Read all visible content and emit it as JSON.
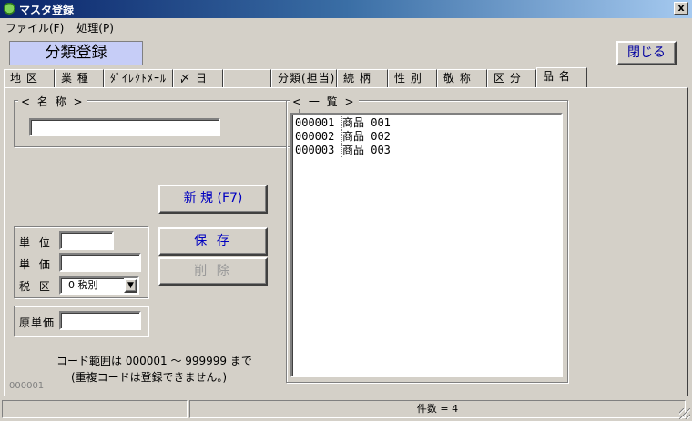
{
  "window": {
    "title": "マスタ登録",
    "close_glyph": "x"
  },
  "menu": [
    {
      "label": "ファイル(F)"
    },
    {
      "label": "処理(P)"
    }
  ],
  "header": {
    "title": "分類登録",
    "close_button": "閉じる"
  },
  "tabs": [
    {
      "label": "地 区"
    },
    {
      "label": "業 種"
    },
    {
      "label": "ﾀﾞｲﾚｸﾄﾒｰﾙ"
    },
    {
      "label": "〆 日"
    },
    {
      "label": ""
    },
    {
      "label": "分類(担当)"
    },
    {
      "label": "続 柄"
    },
    {
      "label": "性 別"
    },
    {
      "label": "敬 称"
    },
    {
      "label": "区 分"
    },
    {
      "label": "品 名"
    }
  ],
  "form": {
    "name_group_label": "< 名 称 >",
    "name_value": "",
    "unit_label": "単 位",
    "unit_value": "",
    "price_label": "単 価",
    "price_value": "",
    "tax_label": "税 区",
    "tax_selected": "0 税別",
    "cost_label": "原単価",
    "cost_value": ""
  },
  "buttons": {
    "new": "新 規 (F7)",
    "save": "保 存",
    "delete": "削 除"
  },
  "list": {
    "group_label": "< 一 覧 >",
    "items": [
      {
        "code": "000001",
        "name": "商品 001"
      },
      {
        "code": "000002",
        "name": "商品 002"
      },
      {
        "code": "000003",
        "name": "商品 003"
      }
    ]
  },
  "notes": {
    "range": "コード範囲は 000001 ～ 999999 まで",
    "duplicate": "(重複コードは登録できません。)",
    "current_code": "000001"
  },
  "status": {
    "count": "件数 = 4"
  }
}
